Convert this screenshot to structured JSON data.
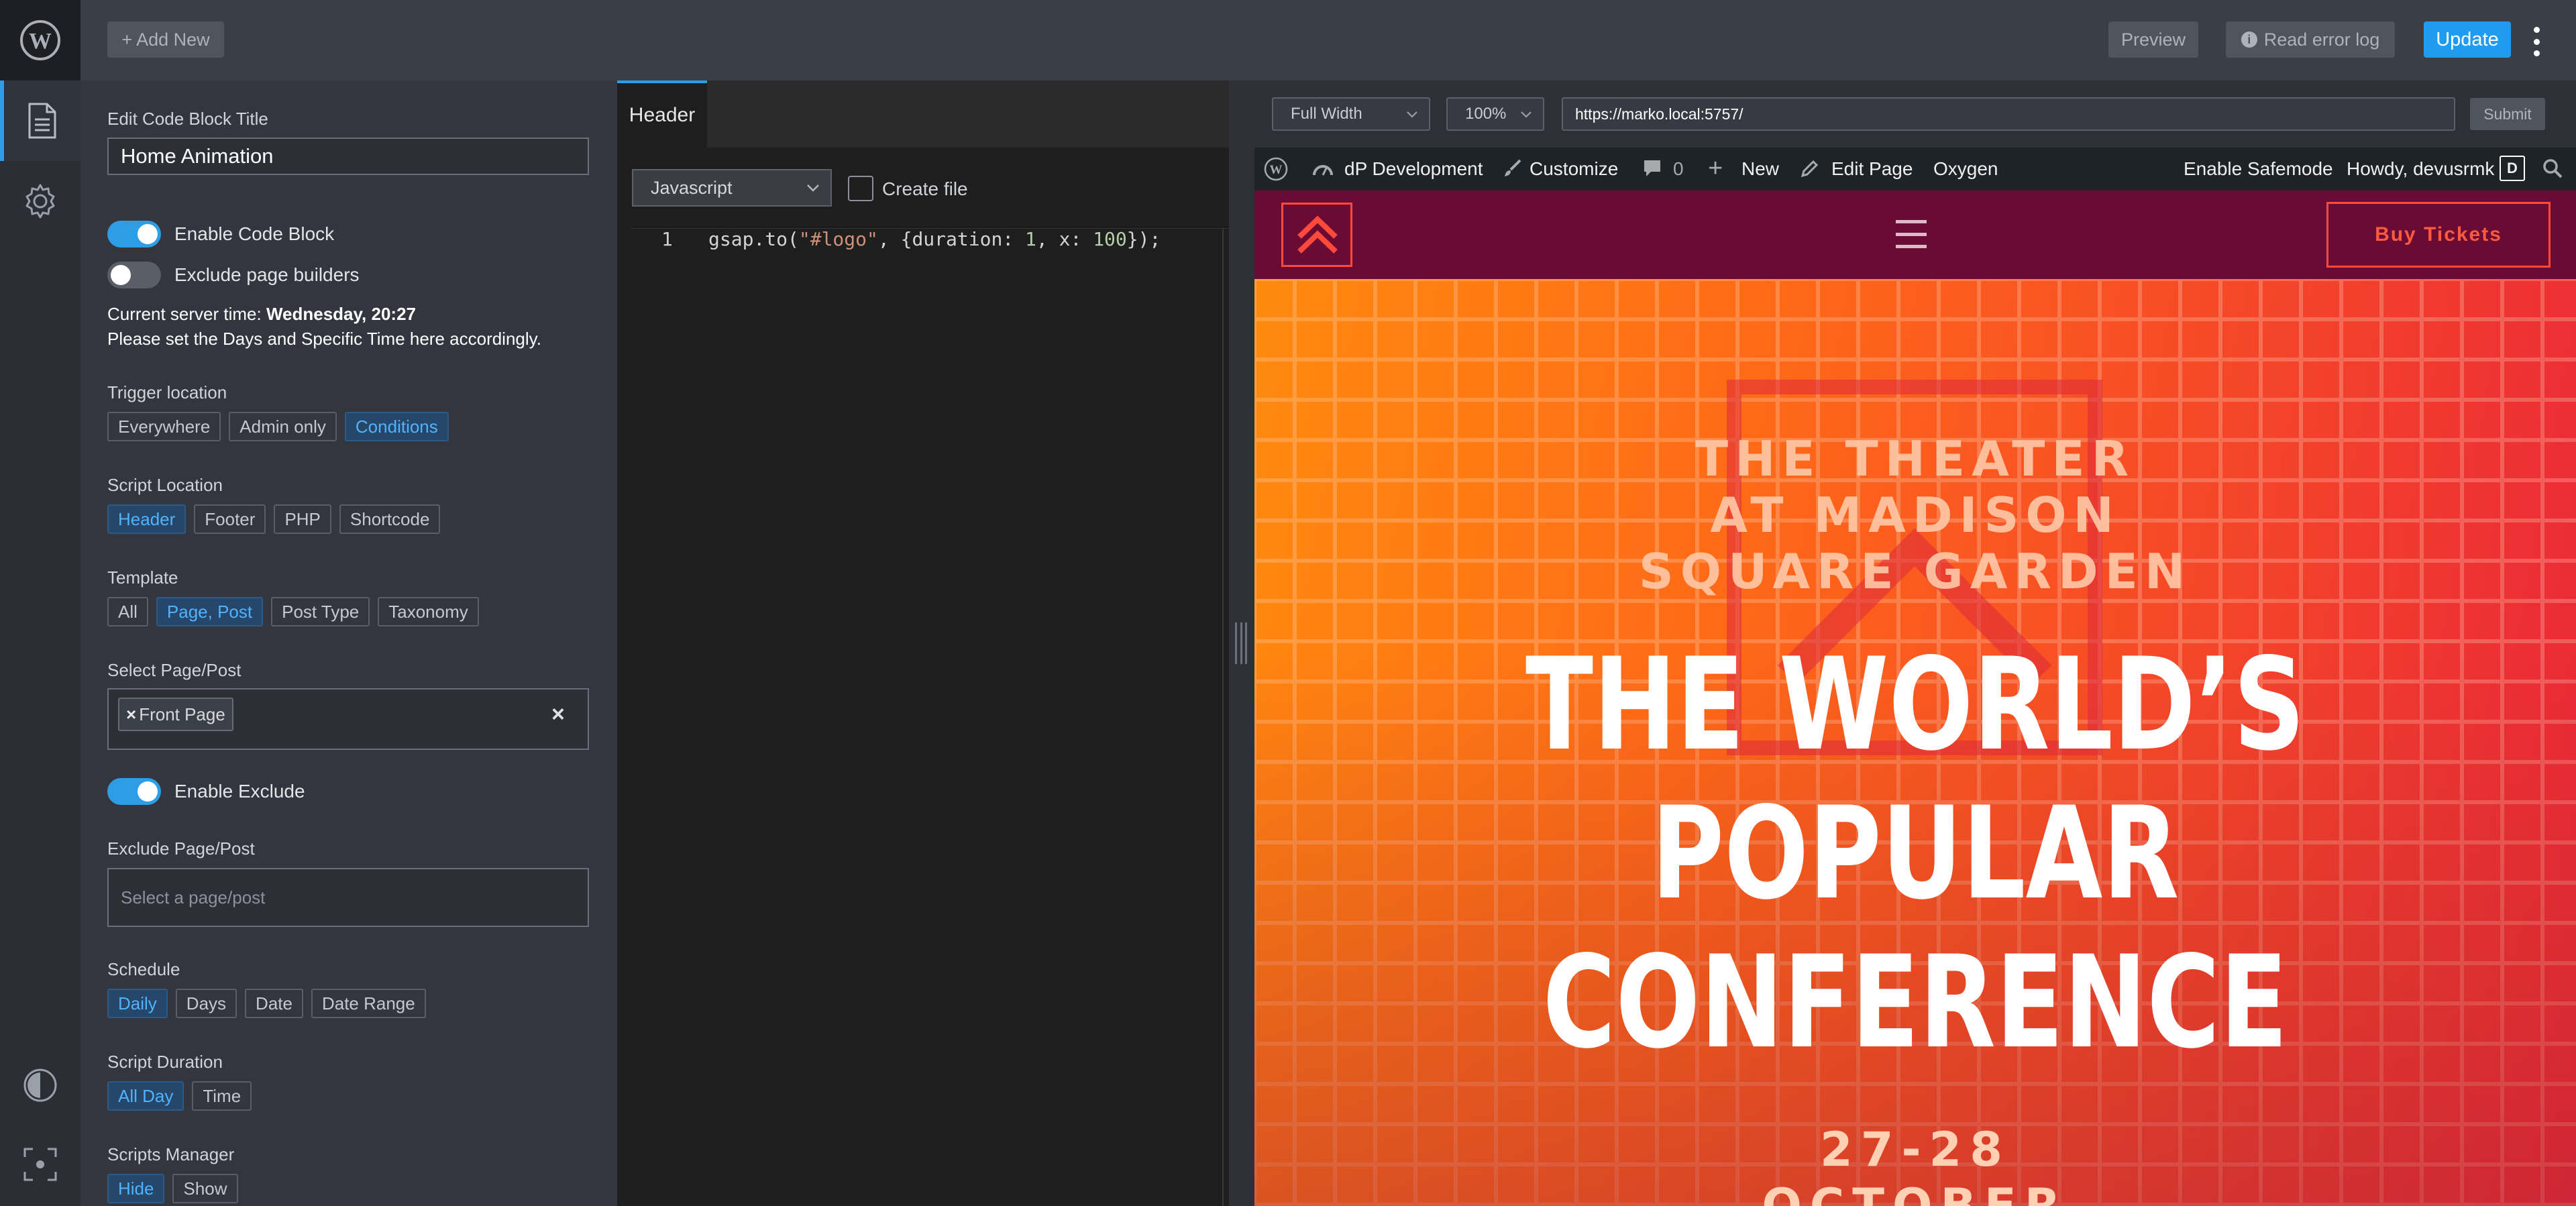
{
  "topbar": {
    "add_new": "+ Add New",
    "preview": "Preview",
    "read_error_log": "Read error log",
    "update": "Update"
  },
  "settings": {
    "title_label": "Edit Code Block Title",
    "title_value": "Home Animation",
    "enable_code_block": "Enable Code Block",
    "exclude_page_builders": "Exclude page builders",
    "server_time_prefix": "Current server time: ",
    "server_time_value": "Wednesday, 20:27",
    "server_time_note": "Please set the Days and Specific Time here accordingly.",
    "trigger_location": {
      "label": "Trigger location",
      "options": [
        "Everywhere",
        "Admin only",
        "Conditions"
      ]
    },
    "script_location": {
      "label": "Script Location",
      "options": [
        "Header",
        "Footer",
        "PHP",
        "Shortcode"
      ]
    },
    "template": {
      "label": "Template",
      "options": [
        "All",
        "Page, Post",
        "Post Type",
        "Taxonomy"
      ]
    },
    "select_page": {
      "label": "Select Page/Post",
      "tag": "Front Page",
      "tag_remove": "×",
      "clear": "×"
    },
    "enable_exclude": "Enable Exclude",
    "exclude_page": {
      "label": "Exclude Page/Post",
      "placeholder": "Select a page/post"
    },
    "schedule": {
      "label": "Schedule",
      "options": [
        "Daily",
        "Days",
        "Date",
        "Date Range"
      ]
    },
    "script_duration": {
      "label": "Script Duration",
      "options": [
        "All Day",
        "Time"
      ]
    },
    "scripts_manager": {
      "label": "Scripts Manager",
      "options": [
        "Hide",
        "Show"
      ]
    }
  },
  "editor": {
    "tab": "Header",
    "language": "Javascript",
    "create_file": "Create file",
    "line_number": "1",
    "code": {
      "fn": "gsap.to(",
      "str": "\"#logo\"",
      "mid1": ", {duration: ",
      "n1": "1",
      "mid2": ", x: ",
      "n2": "100",
      "end": "});"
    }
  },
  "preview": {
    "width_mode": "Full Width",
    "zoom": "100%",
    "url": "https://marko.local:5757/",
    "submit": "Submit",
    "adminbar": {
      "site": "dP Development",
      "customize": "Customize",
      "comments": "0",
      "new": "New",
      "edit_page": "Edit Page",
      "oxygen": "Oxygen",
      "safemode": "Enable Safemode",
      "howdy": "Howdy, devusrmk"
    },
    "buy_tickets": "Buy Tickets",
    "venue": [
      "THE THEATER",
      "AT MADISON",
      "SQUARE GARDEN"
    ],
    "headline": [
      "THE WORLD’S",
      "POPULAR",
      "CONFERENCE"
    ],
    "dates": [
      "27-28",
      "OCTOBER"
    ]
  }
}
